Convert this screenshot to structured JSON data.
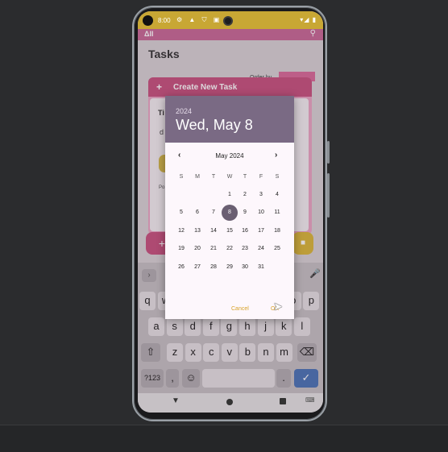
{
  "status": {
    "time": "8:00",
    "icons": "⚙ ▲ ⛉ ▣",
    "right": "▾◢ ▮"
  },
  "appbar": {
    "logo": "ΔII",
    "search_icon": "search-icon"
  },
  "page": {
    "title": "Tasks",
    "order_by": "Order by"
  },
  "card": {
    "header": "Create New Task",
    "field_label": "Ti",
    "frag_d": "d",
    "frag_po": "Po"
  },
  "keyboard": {
    "tool": "›",
    "rows": [
      [
        "q",
        "w",
        "e",
        "r",
        "t",
        "y",
        "u",
        "i",
        "o",
        "p"
      ],
      [
        "a",
        "s",
        "d",
        "f",
        "g",
        "h",
        "j",
        "k",
        "l"
      ],
      [
        "⇧",
        "z",
        "x",
        "c",
        "v",
        "b",
        "n",
        "m",
        "⌫"
      ],
      [
        "?123",
        ",",
        "☺",
        "",
        ".",
        "✓"
      ]
    ]
  },
  "datepicker": {
    "year": "2024",
    "selected_date": "Wed, May 8",
    "month_label": "May 2024",
    "prev": "‹",
    "next": "›",
    "weekdays": [
      "S",
      "M",
      "T",
      "W",
      "T",
      "F",
      "S"
    ],
    "days": [
      "1",
      "2",
      "3",
      "4",
      "5",
      "6",
      "7",
      "8",
      "9",
      "10",
      "11",
      "12",
      "13",
      "14",
      "15",
      "16",
      "17",
      "18",
      "19",
      "20",
      "21",
      "22",
      "23",
      "24",
      "25",
      "26",
      "27",
      "28",
      "29",
      "30",
      "31"
    ],
    "first_weekday_index": 3,
    "selected_day": "8",
    "cancel_label": "Cancel",
    "ok_label": "OK"
  },
  "colors": {
    "primary": "#c7527f",
    "accent": "#d8a329",
    "header": "#7a6a84"
  }
}
